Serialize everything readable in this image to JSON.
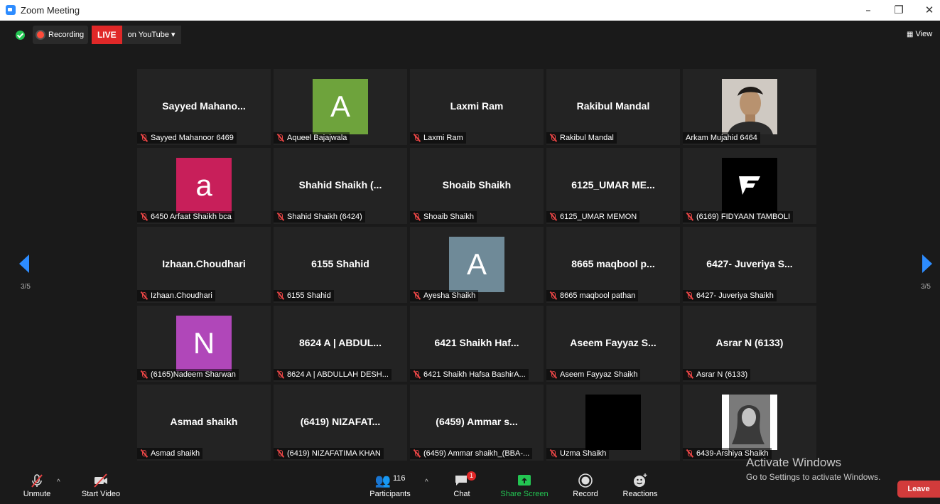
{
  "window": {
    "title": "Zoom Meeting",
    "minimize": "–",
    "restore": "❐",
    "close": "✕"
  },
  "topbar": {
    "recording": "Recording",
    "live": "LIVE",
    "youtube": "on YouTube ▾",
    "view": "View"
  },
  "pagination": {
    "left": "3/5",
    "right": "3/5"
  },
  "tiles": [
    {
      "type": "text",
      "big": "Sayyed  Mahano...",
      "label": "Sayyed Mahanoor 6469"
    },
    {
      "type": "avatar",
      "letter": "A",
      "color": "#6ea33c",
      "label": "Aqueel Bajajwala"
    },
    {
      "type": "text",
      "big": "Laxmi Ram",
      "label": "Laxmi Ram"
    },
    {
      "type": "text",
      "big": "Rakibul Mandal",
      "label": "Rakibul Mandal"
    },
    {
      "type": "photo",
      "label": "Arkam Mujahid 6464"
    },
    {
      "type": "avatar",
      "letter": "a",
      "color": "#c81f5a",
      "label": "6450 Arfaat Shaikh bca"
    },
    {
      "type": "text",
      "big": "Shahid Shaikh (...",
      "label": "Shahid Shaikh (6424)"
    },
    {
      "type": "text",
      "big": "Shoaib Shaikh",
      "label": "Shoaib Shaikh"
    },
    {
      "type": "text",
      "big": "6125_UMAR ME...",
      "label": "6125_UMAR MEMON"
    },
    {
      "type": "logo",
      "label": "(6169) FIDYAAN TAMBOLI"
    },
    {
      "type": "text",
      "big": "Izhaan.Choudhari",
      "label": "Izhaan.Choudhari"
    },
    {
      "type": "text",
      "big": "6155 Shahid",
      "label": "6155 Shahid"
    },
    {
      "type": "avatar",
      "letter": "A",
      "color": "#6f8a98",
      "label": "Ayesha Shaikh"
    },
    {
      "type": "text",
      "big": "8665 maqbool p...",
      "label": "8665 maqbool pathan"
    },
    {
      "type": "text",
      "big": "6427- Juveriya S...",
      "label": "6427- Juveriya Shaikh"
    },
    {
      "type": "avatar",
      "letter": "N",
      "color": "#b047b9",
      "label": "(6165)Nadeem Sharwan"
    },
    {
      "type": "text",
      "big": "8624 A | ABDUL...",
      "label": "8624 A | ABDULLAH DESH..."
    },
    {
      "type": "text",
      "big": "6421 Shaikh Haf...",
      "label": "6421 Shaikh Hafsa BashirA..."
    },
    {
      "type": "text",
      "big": "Aseem Fayyaz S...",
      "label": "Aseem Fayyaz Shaikh"
    },
    {
      "type": "text",
      "big": "Asrar N (6133)",
      "label": "Asrar N (6133)"
    },
    {
      "type": "text",
      "big": "Asmad shaikh",
      "label": "Asmad shaikh"
    },
    {
      "type": "text",
      "big": "(6419) NIZAFAT...",
      "label": "(6419) NIZAFATIMA KHAN"
    },
    {
      "type": "text",
      "big": "(6459) Ammar s...",
      "label": "(6459) Ammar shaikh_(BBA-..."
    },
    {
      "type": "black",
      "label": "Uzma Shaikh"
    },
    {
      "type": "photo2",
      "label": "6439-Arshiya Shaikh"
    }
  ],
  "toolbar": {
    "unmute": "Unmute",
    "start_video": "Start Video",
    "participants": "Participants",
    "participant_count": "116",
    "chat": "Chat",
    "chat_badge": "1",
    "share_screen": "Share Screen",
    "record": "Record",
    "reactions": "Reactions",
    "leave": "Leave"
  },
  "watermark": {
    "line1": "Activate Windows",
    "line2": "Go to Settings to activate Windows."
  }
}
